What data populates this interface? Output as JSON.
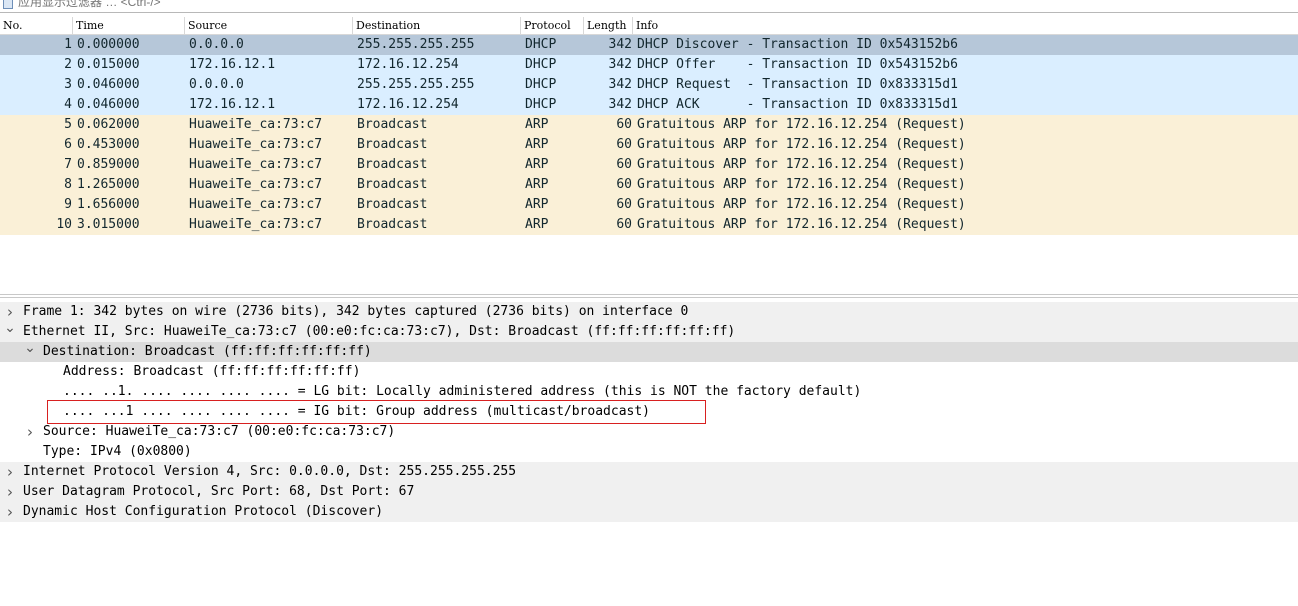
{
  "filter": {
    "placeholder": "应用显示过滤器 … <Ctrl-/>"
  },
  "columns": [
    "No.",
    "Time",
    "Source",
    "Destination",
    "Protocol",
    "Length",
    "Info"
  ],
  "packets": [
    {
      "no": "1",
      "time": "0.000000",
      "src": "0.0.0.0",
      "dst": "255.255.255.255",
      "proto": "DHCP",
      "len": "342",
      "info": "DHCP Discover - Transaction ID 0x543152b6"
    },
    {
      "no": "2",
      "time": "0.015000",
      "src": "172.16.12.1",
      "dst": "172.16.12.254",
      "proto": "DHCP",
      "len": "342",
      "info": "DHCP Offer    - Transaction ID 0x543152b6"
    },
    {
      "no": "3",
      "time": "0.046000",
      "src": "0.0.0.0",
      "dst": "255.255.255.255",
      "proto": "DHCP",
      "len": "342",
      "info": "DHCP Request  - Transaction ID 0x833315d1"
    },
    {
      "no": "4",
      "time": "0.046000",
      "src": "172.16.12.1",
      "dst": "172.16.12.254",
      "proto": "DHCP",
      "len": "342",
      "info": "DHCP ACK      - Transaction ID 0x833315d1"
    },
    {
      "no": "5",
      "time": "0.062000",
      "src": "HuaweiTe_ca:73:c7",
      "dst": "Broadcast",
      "proto": "ARP",
      "len": "60",
      "info": "Gratuitous ARP for 172.16.12.254 (Request)"
    },
    {
      "no": "6",
      "time": "0.453000",
      "src": "HuaweiTe_ca:73:c7",
      "dst": "Broadcast",
      "proto": "ARP",
      "len": "60",
      "info": "Gratuitous ARP for 172.16.12.254 (Request)"
    },
    {
      "no": "7",
      "time": "0.859000",
      "src": "HuaweiTe_ca:73:c7",
      "dst": "Broadcast",
      "proto": "ARP",
      "len": "60",
      "info": "Gratuitous ARP for 172.16.12.254 (Request)"
    },
    {
      "no": "8",
      "time": "1.265000",
      "src": "HuaweiTe_ca:73:c7",
      "dst": "Broadcast",
      "proto": "ARP",
      "len": "60",
      "info": "Gratuitous ARP for 172.16.12.254 (Request)"
    },
    {
      "no": "9",
      "time": "1.656000",
      "src": "HuaweiTe_ca:73:c7",
      "dst": "Broadcast",
      "proto": "ARP",
      "len": "60",
      "info": "Gratuitous ARP for 172.16.12.254 (Request)"
    },
    {
      "no": "10",
      "time": "3.015000",
      "src": "HuaweiTe_ca:73:c7",
      "dst": "Broadcast",
      "proto": "ARP",
      "len": "60",
      "info": "Gratuitous ARP for 172.16.12.254 (Request)"
    }
  ],
  "colors": {
    "selected": "#b6c7d9",
    "dhcp": "#daeeff",
    "arp": "#faf0d7"
  },
  "selected_packet": "1",
  "details": [
    {
      "text": "Frame 1: 342 bytes on wire (2736 bits), 342 bytes captured (2736 bits) on interface 0",
      "level": 0,
      "state": "collapsed"
    },
    {
      "text": "Ethernet II, Src: HuaweiTe_ca:73:c7 (00:e0:fc:ca:73:c7), Dst: Broadcast (ff:ff:ff:ff:ff:ff)",
      "level": 0,
      "state": "expanded"
    },
    {
      "text": "Destination: Broadcast (ff:ff:ff:ff:ff:ff)",
      "level": 1,
      "state": "expanded",
      "selected": true
    },
    {
      "text": "Address: Broadcast (ff:ff:ff:ff:ff:ff)",
      "level": 2,
      "state": "leaf"
    },
    {
      "text": ".... ..1. .... .... .... .... = LG bit: Locally administered address (this is NOT the factory default)",
      "level": 2,
      "state": "leaf"
    },
    {
      "text": ".... ...1 .... .... .... .... = IG bit: Group address (multicast/broadcast)",
      "level": 2,
      "state": "leaf",
      "boxed": true
    },
    {
      "text": "Source: HuaweiTe_ca:73:c7 (00:e0:fc:ca:73:c7)",
      "level": 1,
      "state": "collapsed"
    },
    {
      "text": "Type: IPv4 (0x0800)",
      "level": 1,
      "state": "leaf"
    },
    {
      "text": "Internet Protocol Version 4, Src: 0.0.0.0, Dst: 255.255.255.255",
      "level": 0,
      "state": "collapsed"
    },
    {
      "text": "User Datagram Protocol, Src Port: 68, Dst Port: 67",
      "level": 0,
      "state": "collapsed"
    },
    {
      "text": "Dynamic Host Configuration Protocol (Discover)",
      "level": 0,
      "state": "collapsed"
    }
  ]
}
